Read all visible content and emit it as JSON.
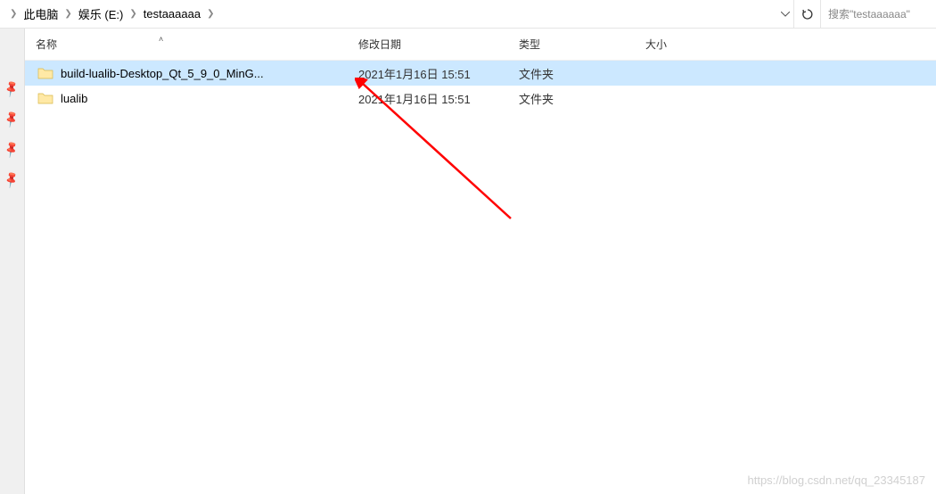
{
  "breadcrumb": {
    "items": [
      "此电脑",
      "娱乐 (E:)",
      "testaaaaaa"
    ]
  },
  "search": {
    "placeholder": "搜索\"testaaaaaa\""
  },
  "columns": {
    "name": "名称",
    "date": "修改日期",
    "type": "类型",
    "size": "大小"
  },
  "files": [
    {
      "name": "build-lualib-Desktop_Qt_5_9_0_MinG...",
      "date": "2021年1月16日 15:51",
      "type": "文件夹",
      "selected": true
    },
    {
      "name": "lualib",
      "date": "2021年1月16日 15:51",
      "type": "文件夹",
      "selected": false
    }
  ],
  "watermark": "https://blog.csdn.net/qq_23345187"
}
